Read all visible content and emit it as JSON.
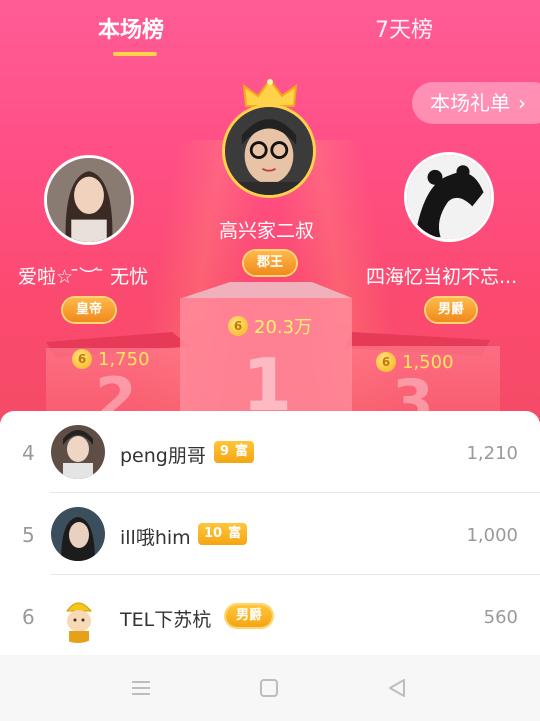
{
  "tabs": [
    {
      "label": "本场榜",
      "active": true
    },
    {
      "label": "7天榜",
      "active": false
    }
  ],
  "gift_list_button": {
    "label": "本场礼单",
    "icon": "chevron-right-icon"
  },
  "podium": [
    {
      "rank": 1,
      "name": "高兴家二叔",
      "badge": "郡王",
      "score": "20.3万"
    },
    {
      "rank": 2,
      "name": "爱啦☆ ̄︶ ̄ 无忧",
      "badge": "皇帝",
      "score": "1,750"
    },
    {
      "rank": 3,
      "name": "四海忆当初不忘...",
      "badge": "男爵",
      "score": "1,500"
    }
  ],
  "list": [
    {
      "rank": "4",
      "name": "peng朋哥",
      "badge_num": "9",
      "badge_text": "富",
      "score": "1,210"
    },
    {
      "rank": "5",
      "name": "ill哦him",
      "badge_num": "10",
      "badge_text": "富",
      "score": "1,000"
    },
    {
      "rank": "6",
      "name": "TEL下苏杭",
      "badge_text": "男爵",
      "score": "560"
    }
  ],
  "colors": {
    "accent_pink": "#ff4f86",
    "gold": "#ffd24a",
    "badge_orange": "#f4a514"
  },
  "navbar_icons": [
    "menu-icon",
    "home-icon",
    "back-icon"
  ]
}
